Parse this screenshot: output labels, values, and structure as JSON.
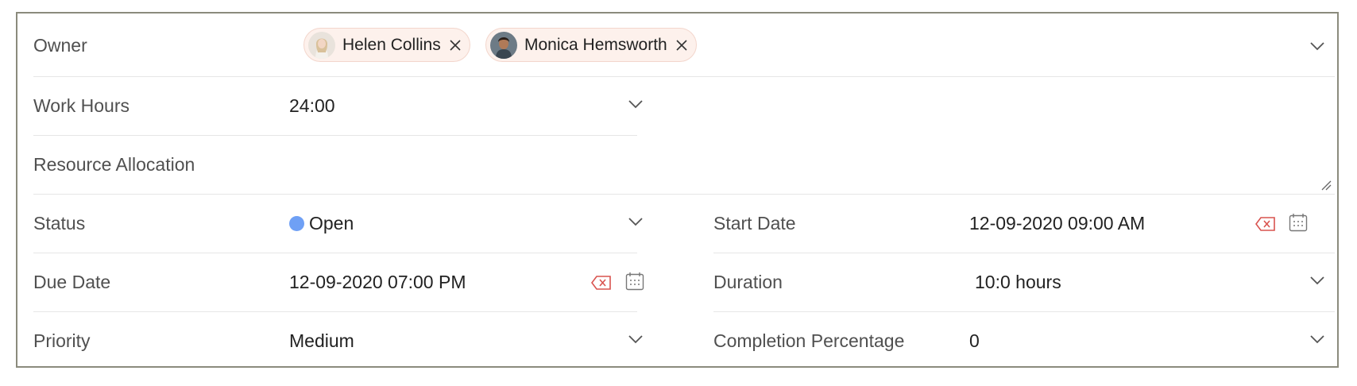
{
  "owner": {
    "label": "Owner",
    "chips": [
      {
        "name": "Helen Collins",
        "avatar_icon": "avatar-woman-icon"
      },
      {
        "name": "Monica Hemsworth",
        "avatar_icon": "avatar-man-icon"
      }
    ]
  },
  "work_hours": {
    "label": "Work Hours",
    "value": "24:00"
  },
  "resource_allocation": {
    "label": "Resource Allocation",
    "value": ""
  },
  "status": {
    "label": "Status",
    "value": "Open",
    "dot_color": "#6fa0f5"
  },
  "start_date": {
    "label": "Start Date",
    "value": "12-09-2020 09:00 AM"
  },
  "due_date": {
    "label": "Due Date",
    "value": "12-09-2020 07:00 PM"
  },
  "duration": {
    "label": "Duration",
    "value": "10:0 hours"
  },
  "priority": {
    "label": "Priority",
    "value": "Medium"
  },
  "completion": {
    "label": "Completion Percentage",
    "value": "0"
  },
  "colors": {
    "clear_icon": "#d9534f",
    "border": "#8b8b7d",
    "chip_bg": "#fdf1ec"
  }
}
